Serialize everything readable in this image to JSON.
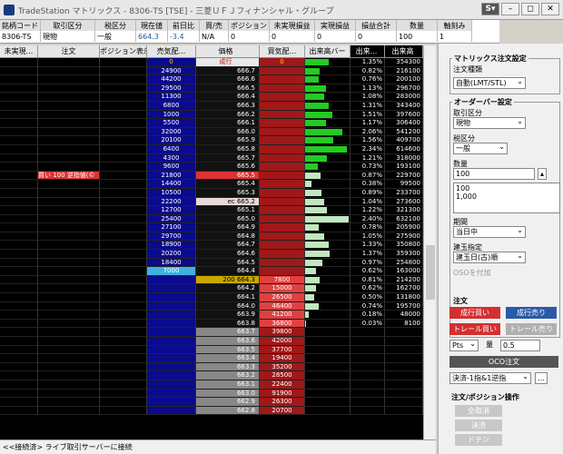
{
  "title": "TradeStation マトリックス - 8306-TS [TSE] - 三菱ＵＦＪフィナンシャル・グループ",
  "window_buttons": [
    "S▾",
    "–",
    "◻",
    "✕"
  ],
  "symbol_header": [
    "銘柄コード",
    "取引区分",
    "税区分",
    "現在値",
    "前日比",
    "買/売",
    "ポジション",
    "未実現損益",
    "実現損益",
    "損益合計",
    "数量",
    "軸刻み"
  ],
  "symbol_values": [
    "8306-TS",
    "現物",
    "一般",
    "664.3",
    "-3.4",
    "N/A",
    "0",
    "0",
    "0",
    "0",
    "100",
    "1"
  ],
  "grid_header": [
    "未実現...",
    "注文",
    "ポジション表示",
    "売気配...",
    "価格",
    "買気配...",
    "出来高バー",
    "出来...",
    "出来高"
  ],
  "order_label": "買い 100 逆指値(©",
  "rows": [
    {
      "bid": "0",
      "price": "成行",
      "ask": "0",
      "pct": "1.35%",
      "vol": "354300",
      "b": 55
    },
    {
      "bid": "24900",
      "price": "666.7",
      "ask": "",
      "pct": "0.82%",
      "vol": "216100",
      "b": 34
    },
    {
      "bid": "44200",
      "price": "666.6",
      "ask": "",
      "pct": "0.76%",
      "vol": "200100",
      "b": 31
    },
    {
      "bid": "29500",
      "price": "666.5",
      "ask": "",
      "pct": "1.13%",
      "vol": "296700",
      "b": 47
    },
    {
      "bid": "11300",
      "price": "666.4",
      "ask": "",
      "pct": "1.08%",
      "vol": "283000",
      "b": 44
    },
    {
      "bid": "6800",
      "price": "666.3",
      "ask": "",
      "pct": "1.31%",
      "vol": "343400",
      "b": 54
    },
    {
      "bid": "1000",
      "price": "666.2",
      "ask": "",
      "pct": "1.51%",
      "vol": "397600",
      "b": 62
    },
    {
      "bid": "5500",
      "price": "666.1",
      "ask": "",
      "pct": "1.17%",
      "vol": "306400",
      "b": 48
    },
    {
      "bid": "32000",
      "price": "666.0",
      "ask": "",
      "pct": "2.06%",
      "vol": "541200",
      "b": 85
    },
    {
      "bid": "20100",
      "price": "665.9",
      "ask": "",
      "pct": "1.56%",
      "vol": "409700",
      "b": 64
    },
    {
      "bid": "6400",
      "price": "665.8",
      "ask": "",
      "pct": "2.34%",
      "vol": "614600",
      "b": 96
    },
    {
      "bid": "4300",
      "price": "665.7",
      "ask": "",
      "pct": "1.21%",
      "vol": "318000",
      "b": 50
    },
    {
      "bid": "9600",
      "price": "665.6",
      "ask": "",
      "pct": "0.73%",
      "vol": "193100",
      "b": 30
    },
    {
      "bid": "21800",
      "price": "665.5",
      "ask": "",
      "pct": "0.87%",
      "vol": "229700",
      "b": 36
    },
    {
      "bid": "14400",
      "price": "665.4",
      "ask": "",
      "pct": "0.38%",
      "vol": "99500",
      "b": 15
    },
    {
      "bid": "10500",
      "price": "665.3",
      "ask": "",
      "pct": "0.89%",
      "vol": "233700",
      "b": 37
    },
    {
      "bid": "22200",
      "price": "ec 665.2",
      "ask": "",
      "pct": "1.04%",
      "vol": "273600",
      "b": 43
    },
    {
      "bid": "12700",
      "price": "665.1",
      "ask": "",
      "pct": "1.22%",
      "vol": "321300",
      "b": 50
    },
    {
      "bid": "25400",
      "price": "665.0",
      "ask": "",
      "pct": "2.40%",
      "vol": "632100",
      "b": 100
    },
    {
      "bid": "27100",
      "price": "664.9",
      "ask": "",
      "pct": "0.78%",
      "vol": "205900",
      "b": 32
    },
    {
      "bid": "29700",
      "price": "664.8",
      "ask": "",
      "pct": "1.05%",
      "vol": "275900",
      "b": 43
    },
    {
      "bid": "18900",
      "price": "664.7",
      "ask": "",
      "pct": "1.33%",
      "vol": "350800",
      "b": 55
    },
    {
      "bid": "20200",
      "price": "664.6",
      "ask": "",
      "pct": "1.37%",
      "vol": "359300",
      "b": 57
    },
    {
      "bid": "18400",
      "price": "664.5",
      "ask": "",
      "pct": "0.97%",
      "vol": "254800",
      "b": 40
    },
    {
      "bid": "7000",
      "price": "664.4",
      "ask": "",
      "pct": "0.62%",
      "vol": "163000",
      "b": 26
    },
    {
      "bid": "",
      "price": "200  664.3",
      "ask": "7800",
      "pct": "0.81%",
      "vol": "214200",
      "b": 34
    },
    {
      "bid": "",
      "price": "664.2",
      "ask": "15000",
      "pct": "0.62%",
      "vol": "162700",
      "b": 26
    },
    {
      "bid": "",
      "price": "664.1",
      "ask": "26500",
      "pct": "0.50%",
      "vol": "131800",
      "b": 21
    },
    {
      "bid": "",
      "price": "664.0",
      "ask": "46400",
      "pct": "0.74%",
      "vol": "195700",
      "b": 31
    },
    {
      "bid": "",
      "price": "663.9",
      "ask": "41200",
      "pct": "0.18%",
      "vol": "48000",
      "b": 8
    },
    {
      "bid": "",
      "price": "663.8",
      "ask": "36800",
      "pct": "0.03%",
      "vol": "8100",
      "b": 2
    },
    {
      "bid": "",
      "price": "663.7",
      "ask": "39800",
      "pct": "",
      "vol": "",
      "b": 0
    },
    {
      "bid": "",
      "price": "663.6",
      "ask": "42000",
      "pct": "",
      "vol": "",
      "b": 0
    },
    {
      "bid": "",
      "price": "663.5",
      "ask": "37700",
      "pct": "",
      "vol": "",
      "b": 0
    },
    {
      "bid": "",
      "price": "663.4",
      "ask": "19400",
      "pct": "",
      "vol": "",
      "b": 0
    },
    {
      "bid": "",
      "price": "663.3",
      "ask": "35200",
      "pct": "",
      "vol": "",
      "b": 0
    },
    {
      "bid": "",
      "price": "663.2",
      "ask": "28500",
      "pct": "",
      "vol": "",
      "b": 0
    },
    {
      "bid": "",
      "price": "663.1",
      "ask": "22400",
      "pct": "",
      "vol": "",
      "b": 0
    },
    {
      "bid": "",
      "price": "663.0",
      "ask": "91900",
      "pct": "",
      "vol": "",
      "b": 0
    },
    {
      "bid": "",
      "price": "662.9",
      "ask": "26300",
      "pct": "",
      "vol": "",
      "b": 0
    },
    {
      "bid": "",
      "price": "662.8",
      "ask": "20700",
      "pct": "",
      "vol": "",
      "b": 0
    }
  ],
  "status": "<<接続済> ライブ取引サーバーに接続",
  "panel": {
    "matrix_title": "マトリックス注文設定",
    "order_type_label": "注文種類",
    "order_type": "自動(LMT/STL)",
    "orderbar_title": "オーダーバー設定",
    "trade_label": "取引区分",
    "trade": "現物",
    "tax_label": "税区分",
    "tax": "一般",
    "qty_label": "数量",
    "qty": "100",
    "qty_list": [
      "100",
      "1,000"
    ],
    "period_label": "期間",
    "period": "当日中",
    "tate_label": "建玉指定",
    "tate": "建玉日(古)順",
    "oso": "OSOを付加",
    "order_title": "注文",
    "mkt_buy": "成行買い",
    "mkt_sell": "成行売り",
    "trail_buy": "トレール買い",
    "trail_sell": "トレール売り",
    "pts": "Pts",
    "amount_label": "量",
    "amount": "0.5",
    "oco": "OCO注文",
    "settle": "決済-1指&1逆指",
    "pos_title": "注文/ポジション操作",
    "b1": "全取消",
    "b2": "決済",
    "b3": "ドテン"
  }
}
